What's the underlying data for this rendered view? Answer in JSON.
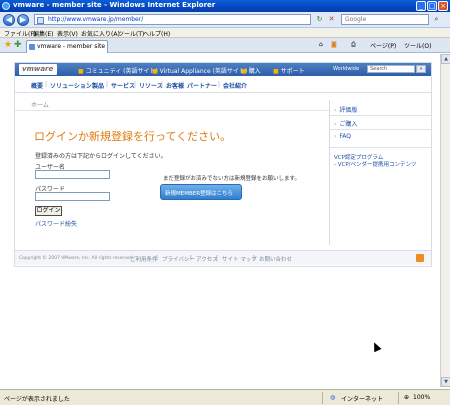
{
  "window": {
    "title": "vmware - member site - Windows Internet Explorer"
  },
  "addressbar": {
    "url": "http://www.vmware.jp/member/",
    "search_placeholder": "Google"
  },
  "menubar": [
    "ファイル(F)",
    "編集(E)",
    "表示(V)",
    "お気に入り(A)",
    "ツール(T)",
    "ヘルプ(H)"
  ],
  "tabs": {
    "active": "vmware - member site"
  },
  "toolbar_right": {
    "page": "ページ(P)",
    "tools": "ツール(O)"
  },
  "site": {
    "logo": "vmware",
    "topnav": [
      "コミュニティ (英語サイト)",
      "Virtual Appliance (英語サイト)",
      "購入",
      "サポート"
    ],
    "worldwide": "Worldwide",
    "search_placeholder": "Search",
    "search_button": "»",
    "mainnav": [
      "概要",
      "ソリューション",
      "製品",
      "サービス",
      "リソース",
      "お客様",
      "パートナー",
      "会社紹介"
    ],
    "breadcrumb": "ホーム",
    "heading": "ログインか新規登録を行ってください。",
    "login": {
      "intro": "登録済みの方は下記からログインしてください。",
      "username_label": "ユーザー名",
      "password_label": "パスワード",
      "button": "ログイン",
      "forgot": "パスワード紛失"
    },
    "register": {
      "text": "まだ登録がお済みでない方は新規登録をお願いします。",
      "button": "新規MEMBER登録はこちら"
    },
    "sidebar": {
      "links": [
        "評価版",
        "ご購入",
        "FAQ"
      ],
      "notes": [
        "VCP認定プログラム",
        "- VCP/ベンダー提携用コンテンツ"
      ]
    },
    "footer": {
      "copyright": "Copyright © 2007 VMware, Inc. All rights reserved.",
      "links": [
        "ご利用条件",
        "プライバシー",
        "アクセス",
        "サイト マップ",
        "お問い合わせ"
      ]
    }
  },
  "statusbar": {
    "text": "ページが表示されました",
    "zone": "インターネット",
    "zoom": "100%"
  }
}
